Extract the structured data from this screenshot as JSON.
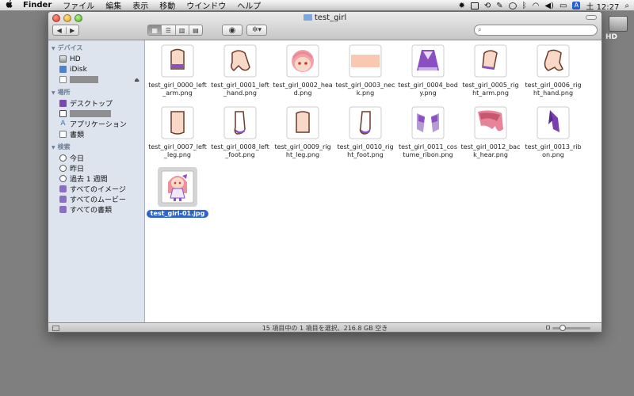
{
  "menubar": {
    "apple": "",
    "app": "Finder",
    "items": [
      "ファイル",
      "編集",
      "表示",
      "移動",
      "ウインドウ",
      "ヘルプ"
    ],
    "status_a": "A",
    "clock": "土 12:27"
  },
  "desktop": {
    "hd_label": "HD"
  },
  "window": {
    "title": "test_girl",
    "nav_back": "◀",
    "nav_forward": "▶",
    "view_modes": [
      "▦",
      "☰",
      "▥",
      "▤"
    ],
    "quicklook": "◉",
    "action": "✲▾",
    "search_placeholder": ""
  },
  "sidebar": {
    "devices_header": "デバイス",
    "devices": [
      {
        "label": "HD",
        "icon": "hd-icon"
      },
      {
        "label": "iDisk",
        "icon": "idisk-icon"
      },
      {
        "label": "",
        "icon": "disk-icon",
        "eject": "⏏"
      }
    ],
    "places_header": "場所",
    "places": [
      {
        "label": "デスクトップ",
        "icon": "desktop-icon"
      },
      {
        "label": "",
        "icon": "home-icon"
      },
      {
        "label": "アプリケーション",
        "icon": "applications-icon"
      },
      {
        "label": "書類",
        "icon": "documents-icon"
      }
    ],
    "search_header": "検索",
    "searches": [
      {
        "label": "今日",
        "icon": "clock-icon"
      },
      {
        "label": "昨日",
        "icon": "clock-icon"
      },
      {
        "label": "過去 1 週間",
        "icon": "clock-icon"
      },
      {
        "label": "すべてのイメージ",
        "icon": "smart-folder-icon"
      },
      {
        "label": "すべてのムービー",
        "icon": "smart-folder-icon"
      },
      {
        "label": "すべての書類",
        "icon": "smart-folder-icon"
      }
    ]
  },
  "files": [
    {
      "name": "test_girl_0000_left_arm.png",
      "thumb": "left-arm-icon"
    },
    {
      "name": "test_girl_0001_left_hand.png",
      "thumb": "left-hand-icon"
    },
    {
      "name": "test_girl_0002_head.png",
      "thumb": "head-icon"
    },
    {
      "name": "test_girl_0003_neck.png",
      "thumb": "neck-icon"
    },
    {
      "name": "test_girl_0004_body.png",
      "thumb": "body-icon"
    },
    {
      "name": "test_girl_0005_right_arm.png",
      "thumb": "right-arm-icon"
    },
    {
      "name": "test_girl_0006_right_hand.png",
      "thumb": "right-hand-icon"
    },
    {
      "name": "test_girl_0007_left_leg.png",
      "thumb": "left-leg-icon"
    },
    {
      "name": "test_girl_0008_left_foot.png",
      "thumb": "left-foot-icon"
    },
    {
      "name": "test_girl_0009_right_leg.png",
      "thumb": "right-leg-icon"
    },
    {
      "name": "test_girl_0010_right_foot.png",
      "thumb": "right-foot-icon"
    },
    {
      "name": "test_girl_0011_costume_ribon.png",
      "thumb": "ribbon-icon"
    },
    {
      "name": "test_girl_0012_back_hear.png",
      "thumb": "back-hair-icon"
    },
    {
      "name": "test_girl_0013_ribon.png",
      "thumb": "ribbon-small-icon"
    },
    {
      "name": "test_girl-01.jpg",
      "thumb": "character-icon",
      "selected": true
    }
  ],
  "status": {
    "text": "15 項目中の 1 項目を選択、216.8 GB 空き"
  },
  "colors": {
    "selection": "#2f65c7",
    "sidebar": "#dde4ee",
    "skin": "#f8d9c8",
    "outline": "#6b3a2a",
    "purple": "#8a4fc0"
  }
}
